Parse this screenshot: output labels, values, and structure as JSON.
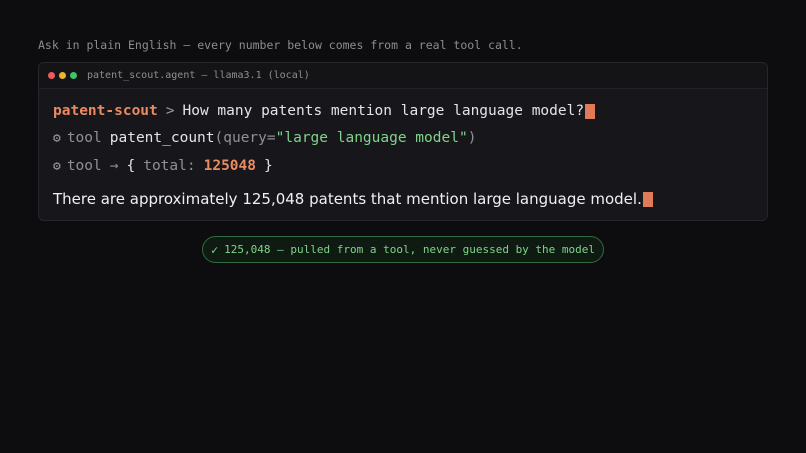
{
  "caption": "Ask in plain English — every number below comes from a real tool call.",
  "window": {
    "title": "patent_scout.agent — llama3.1 (local)"
  },
  "terminal": {
    "prompt_name": "patent-scout",
    "prompt_sep": ">",
    "question": "How many patents mention large language model?",
    "tool_label": "tool",
    "tool_fn": "patent_count",
    "tool_open": "(query=",
    "tool_arg": "\"large language model\"",
    "tool_close": ")",
    "result_arrow": "→",
    "result_open": "{",
    "result_key": "total:",
    "result_value": "125048",
    "result_close": "}",
    "answer": "There are approximately 125,048 patents that mention large language model."
  },
  "badge": {
    "check": "✓",
    "text": "125,048 — pulled from a tool, never guessed by the model"
  },
  "colors": {
    "accent": "#e98a62",
    "string": "#7fd48a",
    "cursor": "#e07b5a"
  }
}
